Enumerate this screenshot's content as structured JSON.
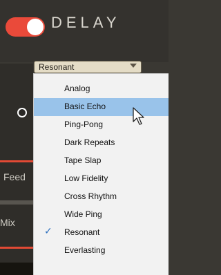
{
  "header": {
    "title": "DELAY",
    "power_on": true
  },
  "preset": {
    "selected": "Resonant",
    "options": [
      "Analog",
      "Basic Echo",
      "Ping-Pong",
      "Dark Repeats",
      "Tape Slap",
      "Low Fidelity",
      "Cross Rhythm",
      "Wide Ping",
      "Resonant",
      "Everlasting"
    ],
    "hovered_index": 1,
    "checked_index": 8
  },
  "side_labels": {
    "feed": "Feed",
    "mix": "Mix"
  },
  "colors": {
    "accent": "#ea4a3a",
    "highlight": "#99c3ea",
    "background": "#3a3833"
  },
  "icons": {
    "check": "checkmark-icon",
    "cursor": "mouse-pointer-icon"
  }
}
